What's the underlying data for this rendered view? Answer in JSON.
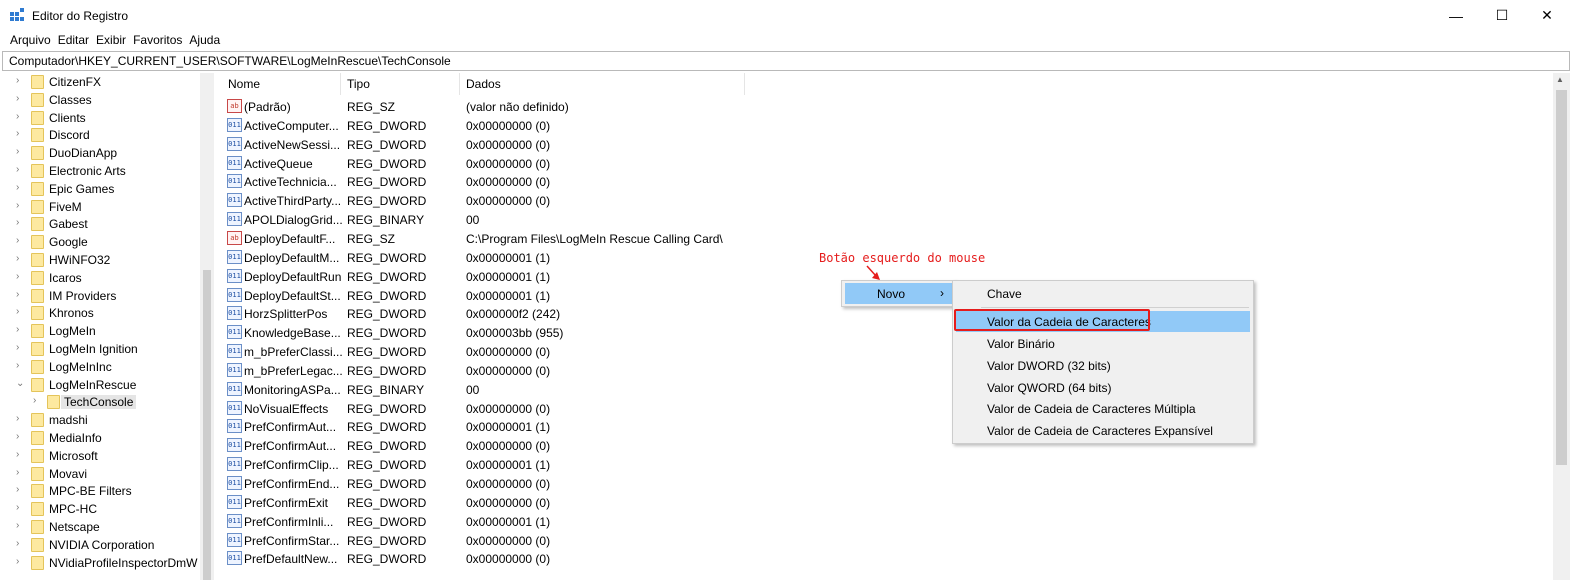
{
  "window": {
    "title": "Editor do Registro",
    "minimize": "—",
    "maximize": "☐",
    "close": "✕"
  },
  "menu": [
    "Arquivo",
    "Editar",
    "Exibir",
    "Favoritos",
    "Ajuda"
  ],
  "address": "Computador\\HKEY_CURRENT_USER\\SOFTWARE\\LogMeInRescue\\TechConsole",
  "tree": {
    "items": [
      {
        "label": "CitizenFX",
        "chev": "›"
      },
      {
        "label": "Classes",
        "chev": "›"
      },
      {
        "label": "Clients",
        "chev": "›"
      },
      {
        "label": "Discord",
        "chev": "›"
      },
      {
        "label": "DuoDianApp",
        "chev": "›"
      },
      {
        "label": "Electronic Arts",
        "chev": "›"
      },
      {
        "label": "Epic Games",
        "chev": "›"
      },
      {
        "label": "FiveM",
        "chev": "›"
      },
      {
        "label": "Gabest",
        "chev": "›"
      },
      {
        "label": "Google",
        "chev": "›"
      },
      {
        "label": "HWiNFO32",
        "chev": "›"
      },
      {
        "label": "Icaros",
        "chev": "›"
      },
      {
        "label": "IM Providers",
        "chev": "›"
      },
      {
        "label": "Khronos",
        "chev": "›"
      },
      {
        "label": "LogMeIn",
        "chev": "›"
      },
      {
        "label": "LogMeIn Ignition",
        "chev": "›"
      },
      {
        "label": "LogMeInInc",
        "chev": "›"
      },
      {
        "label": "LogMeInRescue",
        "chev": "⌄"
      },
      {
        "label": "TechConsole",
        "chev": "›"
      },
      {
        "label": "madshi",
        "chev": "›"
      },
      {
        "label": "MediaInfo",
        "chev": "›"
      },
      {
        "label": "Microsoft",
        "chev": "›"
      },
      {
        "label": "Movavi",
        "chev": "›"
      },
      {
        "label": "MPC-BE Filters",
        "chev": "›"
      },
      {
        "label": "MPC-HC",
        "chev": "›"
      },
      {
        "label": "Netscape",
        "chev": "›"
      },
      {
        "label": "NVIDIA Corporation",
        "chev": "›"
      },
      {
        "label": "NVidiaProfileInspectorDmW",
        "chev": "›"
      }
    ]
  },
  "columns": {
    "name": "Nome",
    "type": "Tipo",
    "data": "Dados"
  },
  "values": [
    {
      "icon": "ab",
      "name": "(Padrão)",
      "type": "REG_SZ",
      "data": "(valor não definido)"
    },
    {
      "icon": "011",
      "name": "ActiveComputer...",
      "type": "REG_DWORD",
      "data": "0x00000000 (0)"
    },
    {
      "icon": "011",
      "name": "ActiveNewSessi...",
      "type": "REG_DWORD",
      "data": "0x00000000 (0)"
    },
    {
      "icon": "011",
      "name": "ActiveQueue",
      "type": "REG_DWORD",
      "data": "0x00000000 (0)"
    },
    {
      "icon": "011",
      "name": "ActiveTechnicia...",
      "type": "REG_DWORD",
      "data": "0x00000000 (0)"
    },
    {
      "icon": "011",
      "name": "ActiveThirdParty...",
      "type": "REG_DWORD",
      "data": "0x00000000 (0)"
    },
    {
      "icon": "011",
      "name": "APOLDialogGrid...",
      "type": "REG_BINARY",
      "data": "00"
    },
    {
      "icon": "ab",
      "name": "DeployDefaultF...",
      "type": "REG_SZ",
      "data": "C:\\Program Files\\LogMeIn Rescue Calling Card\\"
    },
    {
      "icon": "011",
      "name": "DeployDefaultM...",
      "type": "REG_DWORD",
      "data": "0x00000001 (1)"
    },
    {
      "icon": "011",
      "name": "DeployDefaultRun",
      "type": "REG_DWORD",
      "data": "0x00000001 (1)"
    },
    {
      "icon": "011",
      "name": "DeployDefaultSt...",
      "type": "REG_DWORD",
      "data": "0x00000001 (1)"
    },
    {
      "icon": "011",
      "name": "HorzSplitterPos",
      "type": "REG_DWORD",
      "data": "0x000000f2 (242)"
    },
    {
      "icon": "011",
      "name": "KnowledgeBase...",
      "type": "REG_DWORD",
      "data": "0x000003bb (955)"
    },
    {
      "icon": "011",
      "name": "m_bPreferClassi...",
      "type": "REG_DWORD",
      "data": "0x00000000 (0)"
    },
    {
      "icon": "011",
      "name": "m_bPreferLegac...",
      "type": "REG_DWORD",
      "data": "0x00000000 (0)"
    },
    {
      "icon": "011",
      "name": "MonitoringASPa...",
      "type": "REG_BINARY",
      "data": "00"
    },
    {
      "icon": "011",
      "name": "NoVisualEffects",
      "type": "REG_DWORD",
      "data": "0x00000000 (0)"
    },
    {
      "icon": "011",
      "name": "PrefConfirmAut...",
      "type": "REG_DWORD",
      "data": "0x00000001 (1)"
    },
    {
      "icon": "011",
      "name": "PrefConfirmAut...",
      "type": "REG_DWORD",
      "data": "0x00000000 (0)"
    },
    {
      "icon": "011",
      "name": "PrefConfirmClip...",
      "type": "REG_DWORD",
      "data": "0x00000001 (1)"
    },
    {
      "icon": "011",
      "name": "PrefConfirmEnd...",
      "type": "REG_DWORD",
      "data": "0x00000000 (0)"
    },
    {
      "icon": "011",
      "name": "PrefConfirmExit",
      "type": "REG_DWORD",
      "data": "0x00000000 (0)"
    },
    {
      "icon": "011",
      "name": "PrefConfirmInli...",
      "type": "REG_DWORD",
      "data": "0x00000001 (1)"
    },
    {
      "icon": "011",
      "name": "PrefConfirmStar...",
      "type": "REG_DWORD",
      "data": "0x00000000 (0)"
    },
    {
      "icon": "011",
      "name": "PrefDefaultNew...",
      "type": "REG_DWORD",
      "data": "0x00000000 (0)"
    }
  ],
  "context_menu": {
    "item": "Novo",
    "arrow": "›",
    "submenu": [
      "Chave",
      "Valor da Cadeia de Caracteres",
      "Valor Binário",
      "Valor DWORD (32 bits)",
      "Valor QWORD (64 bits)",
      "Valor de Cadeia de Caracteres Múltipla",
      "Valor de Cadeia de Caracteres Expansível"
    ]
  },
  "annotation": "Botão esquerdo do mouse",
  "colors": {
    "highlight": "#91c9f7",
    "annotation": "#e51c1c"
  }
}
